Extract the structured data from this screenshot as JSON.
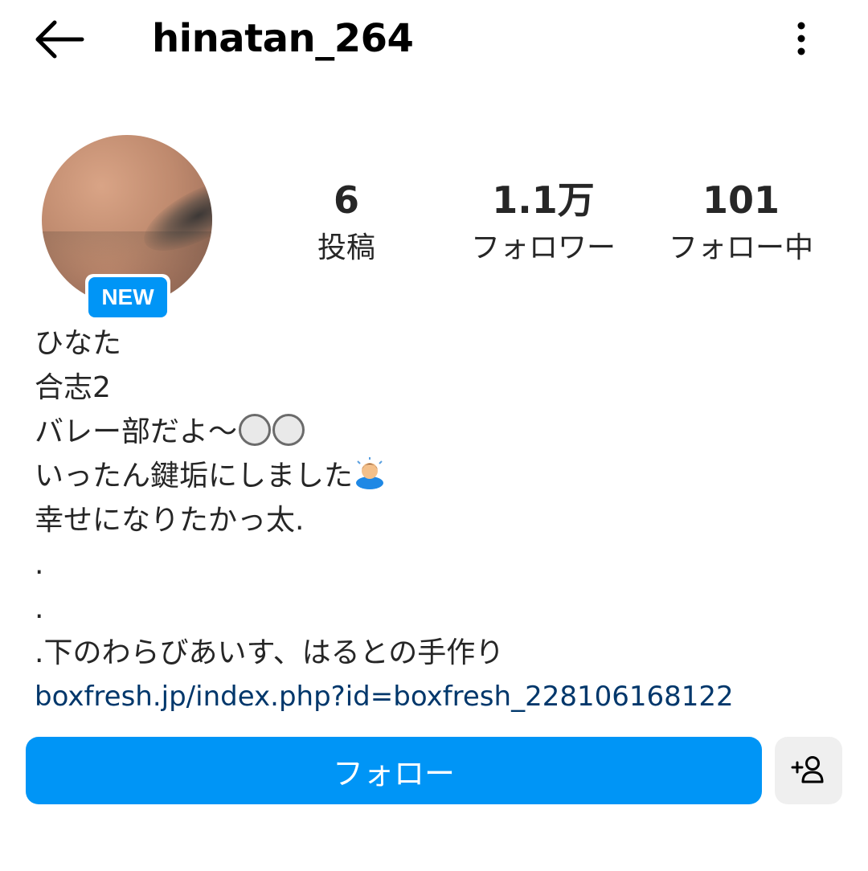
{
  "header": {
    "username": "hinatan_264",
    "back_icon": "arrow-left-icon",
    "more_icon": "more-vertical-icon"
  },
  "profile": {
    "badge": "NEW",
    "stats": {
      "posts_value": "6",
      "posts_label": "投稿",
      "followers_value": "1.1万",
      "followers_label": "フォロワー",
      "following_value": "101",
      "following_label": "フォロー中"
    }
  },
  "bio": {
    "name": "ひなた",
    "line1": "合志2",
    "line2": "バレー部だよ〜",
    "line3": "いったん鍵垢にしました",
    "line4": "幸せになりたかっ太.",
    "line5": ".",
    "line6": ".",
    "line7": ".下のわらびあいす、はるとの手作り",
    "link": "boxfresh.jp/index.php?id=boxfresh_228106168122"
  },
  "actions": {
    "follow_label": "フォロー",
    "suggest_icon": "add-person-icon"
  },
  "colors": {
    "accent": "#0095f6",
    "secondary_button": "#efefef",
    "text": "#262626",
    "link": "#00376b"
  }
}
